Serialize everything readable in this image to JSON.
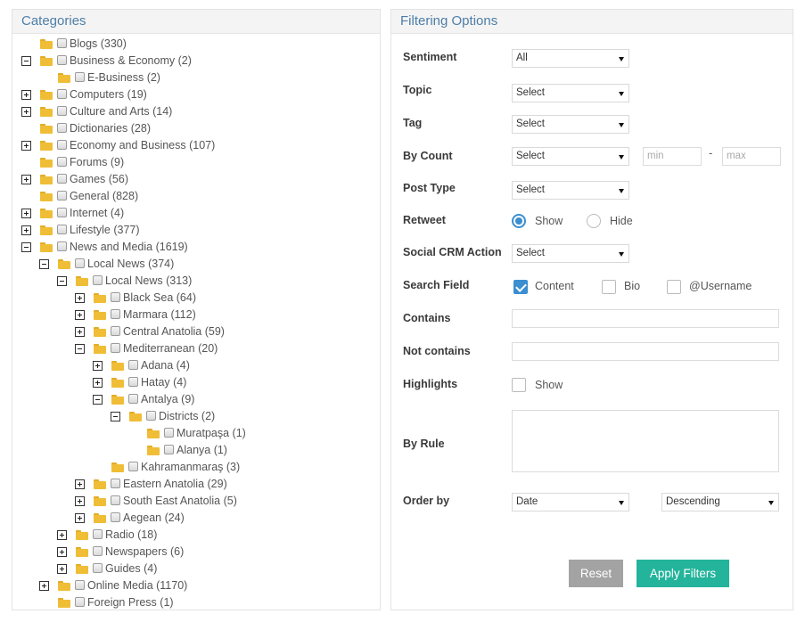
{
  "categories": {
    "title": "Categories",
    "tree": [
      {
        "label": "Blogs (330)",
        "level": 0,
        "toggle": "none"
      },
      {
        "label": "Business & Economy (2)",
        "level": 0,
        "toggle": "minus"
      },
      {
        "label": "E-Business (2)",
        "level": 1,
        "toggle": "none"
      },
      {
        "label": "Computers (19)",
        "level": 0,
        "toggle": "plus"
      },
      {
        "label": "Culture and Arts (14)",
        "level": 0,
        "toggle": "plus"
      },
      {
        "label": "Dictionaries (28)",
        "level": 0,
        "toggle": "none"
      },
      {
        "label": "Economy and Business (107)",
        "level": 0,
        "toggle": "plus"
      },
      {
        "label": "Forums (9)",
        "level": 0,
        "toggle": "none"
      },
      {
        "label": "Games (56)",
        "level": 0,
        "toggle": "plus"
      },
      {
        "label": "General (828)",
        "level": 0,
        "toggle": "none"
      },
      {
        "label": "Internet (4)",
        "level": 0,
        "toggle": "plus"
      },
      {
        "label": "Lifestyle (377)",
        "level": 0,
        "toggle": "plus"
      },
      {
        "label": "News and Media (1619)",
        "level": 0,
        "toggle": "minus"
      },
      {
        "label": "Local News (374)",
        "level": 1,
        "toggle": "minus"
      },
      {
        "label": "Local News (313)",
        "level": 2,
        "toggle": "minus"
      },
      {
        "label": "Black Sea (64)",
        "level": 3,
        "toggle": "plus"
      },
      {
        "label": "Marmara (112)",
        "level": 3,
        "toggle": "plus"
      },
      {
        "label": "Central Anatolia (59)",
        "level": 3,
        "toggle": "plus"
      },
      {
        "label": "Mediterranean (20)",
        "level": 3,
        "toggle": "minus"
      },
      {
        "label": "Adana (4)",
        "level": 4,
        "toggle": "plus"
      },
      {
        "label": "Hatay (4)",
        "level": 4,
        "toggle": "plus"
      },
      {
        "label": "Antalya (9)",
        "level": 4,
        "toggle": "minus"
      },
      {
        "label": "Districts (2)",
        "level": 5,
        "toggle": "minus"
      },
      {
        "label": "Muratpaşa (1)",
        "level": 6,
        "toggle": "none"
      },
      {
        "label": "Alanya (1)",
        "level": 6,
        "toggle": "none"
      },
      {
        "label": "Kahramanmaraş (3)",
        "level": 4,
        "toggle": "none"
      },
      {
        "label": "Eastern Anatolia (29)",
        "level": 3,
        "toggle": "plus"
      },
      {
        "label": "South East Anatolia (5)",
        "level": 3,
        "toggle": "plus"
      },
      {
        "label": "Aegean (24)",
        "level": 3,
        "toggle": "plus"
      },
      {
        "label": "Radio (18)",
        "level": 2,
        "toggle": "plus"
      },
      {
        "label": "Newspapers (6)",
        "level": 2,
        "toggle": "plus"
      },
      {
        "label": "Guides (4)",
        "level": 2,
        "toggle": "plus"
      },
      {
        "label": "Online Media (1170)",
        "level": 1,
        "toggle": "plus"
      },
      {
        "label": "Foreign Press (1)",
        "level": 1,
        "toggle": "none"
      }
    ]
  },
  "filters": {
    "title": "Filtering Options",
    "sentiment": {
      "label": "Sentiment",
      "value": "All"
    },
    "topic": {
      "label": "Topic",
      "value": "Select"
    },
    "tag": {
      "label": "Tag",
      "value": "Select"
    },
    "by_count": {
      "label": "By Count",
      "value": "Select",
      "min_placeholder": "min",
      "max_placeholder": "max",
      "separator": "-"
    },
    "post_type": {
      "label": "Post Type",
      "value": "Select"
    },
    "retweet": {
      "label": "Retweet",
      "options": [
        "Show",
        "Hide"
      ],
      "selected": "Show"
    },
    "social_crm": {
      "label": "Social CRM Action",
      "value": "Select"
    },
    "search_field": {
      "label": "Search Field",
      "options": [
        {
          "label": "Content",
          "checked": true
        },
        {
          "label": "Bio",
          "checked": false
        },
        {
          "label": "@Username",
          "checked": false
        }
      ]
    },
    "contains": {
      "label": "Contains",
      "value": ""
    },
    "not_contains": {
      "label": "Not contains",
      "value": ""
    },
    "highlights": {
      "label": "Highlights",
      "option": "Show",
      "checked": false
    },
    "by_rule": {
      "label": "By Rule",
      "value": ""
    },
    "order_by": {
      "label": "Order by",
      "field": "Date",
      "direction": "Descending"
    }
  },
  "buttons": {
    "reset": "Reset",
    "apply": "Apply Filters"
  },
  "colors": {
    "accent": "#3b8ed0",
    "apply": "#23b49b",
    "reset": "#a3a3a3",
    "header_text": "#4d7ea8",
    "folder": "#f0bd36"
  }
}
